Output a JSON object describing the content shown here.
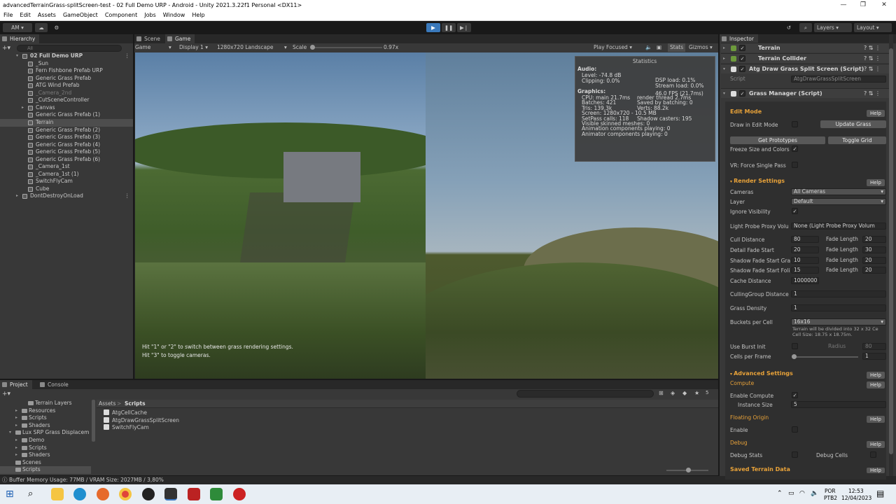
{
  "window": {
    "title": "advancedTerrainGrass-splitScreen-test - 02 Full Demo URP - Android - Unity 2021.3.22f1 Personal <DX11>",
    "min": "—",
    "max": "❐",
    "close": "✕"
  },
  "menu": [
    "File",
    "Edit",
    "Assets",
    "GameObject",
    "Component",
    "Jobs",
    "Window",
    "Help"
  ],
  "toolbar": {
    "account": "AM",
    "layers": "Layers",
    "layout": "Layout"
  },
  "hierarchy": {
    "tab": "Hierarchy",
    "search_placeholder": "All",
    "items": [
      {
        "label": "02 Full Demo URP",
        "indent": 0,
        "bold": true
      },
      {
        "label": "_Sun",
        "indent": 1
      },
      {
        "label": "Fern Fishbone Prefab URP",
        "indent": 1
      },
      {
        "label": "Generic Grass Prefab",
        "indent": 1
      },
      {
        "label": "ATG Wind Prefab",
        "indent": 1
      },
      {
        "label": "_Camera_2nd",
        "indent": 1,
        "dim": true
      },
      {
        "label": "_CutSceneController",
        "indent": 1
      },
      {
        "label": "Canvas",
        "indent": 1,
        "arrow": true
      },
      {
        "label": "Generic Grass Prefab (1)",
        "indent": 1
      },
      {
        "label": "Terrain",
        "indent": 1,
        "selected": true
      },
      {
        "label": "Generic Grass Prefab (2)",
        "indent": 1
      },
      {
        "label": "Generic Grass Prefab (3)",
        "indent": 1
      },
      {
        "label": "Generic Grass Prefab (4)",
        "indent": 1
      },
      {
        "label": "Generic Grass Prefab (5)",
        "indent": 1
      },
      {
        "label": "Generic Grass Prefab (6)",
        "indent": 1
      },
      {
        "label": "_Camera_1st",
        "indent": 1
      },
      {
        "label": "_Camera_1st (1)",
        "indent": 1
      },
      {
        "label": "SwitchFlyCam",
        "indent": 1
      },
      {
        "label": "Cube",
        "indent": 1
      },
      {
        "label": "DontDestroyOnLoad",
        "indent": 0
      }
    ]
  },
  "game": {
    "tabs": [
      "Scene",
      "Game"
    ],
    "mode": "Game",
    "display": "Display 1",
    "resolution": "1280x720 Landscape",
    "scale_label": "Scale",
    "scale_value": "0.97x",
    "play_mode": "Play Focused",
    "stats": "Stats",
    "gizmos": "Gizmos",
    "hint1": "Hit \"1\" or \"2\" to switch between grass rendering settings.",
    "hint2": "Hit \"3\" to toggle cameras.",
    "statistics": {
      "title": "Statistics",
      "audio_header": "Audio:",
      "audio_left": [
        "Level: -74.8 dB",
        "Clipping: 0.0%"
      ],
      "audio_right": [
        "DSP load: 0.1%",
        "Stream load: 0.0%"
      ],
      "fps": "46.0 FPS (21.7ms)",
      "graphics_header": "Graphics:",
      "graphics_left": [
        "CPU: main 21.7ms",
        "Batches: 421",
        "Tris: 139.3k",
        "Screen: 1280x720 - 10.5 MB",
        "SetPass calls: 118",
        "Visible skinned meshes: 0",
        "Animation components playing: 0",
        "Animator components playing: 0"
      ],
      "graphics_right": [
        "render thread 2.7ms",
        "Saved by batching: 0",
        "Verts: 88.2k",
        "",
        "Shadow casters: 195",
        "",
        "",
        ""
      ]
    }
  },
  "project": {
    "tabs": [
      "Project",
      "Console"
    ],
    "tree": [
      {
        "label": "Terrain Layers",
        "indent": 2
      },
      {
        "label": "Resources",
        "indent": 1,
        "arrow": true
      },
      {
        "label": "Scripts",
        "indent": 1,
        "arrow": true
      },
      {
        "label": "Shaders",
        "indent": 1,
        "arrow": true
      },
      {
        "label": "Lux SRP Grass Displacem",
        "indent": 0,
        "arrow": true
      },
      {
        "label": "Demo",
        "indent": 1,
        "arrow": true
      },
      {
        "label": "Scripts",
        "indent": 1,
        "arrow": true
      },
      {
        "label": "Shaders",
        "indent": 1,
        "arrow": true
      },
      {
        "label": "Scenes",
        "indent": 0
      },
      {
        "label": "Scripts",
        "indent": 0,
        "selected": true
      }
    ],
    "breadcrumb": [
      "Assets",
      "Scripts"
    ],
    "files": [
      "AtgCellCache",
      "AtgDrawGrassSplitScreen",
      "SwitchFlyCam"
    ],
    "badge": "5"
  },
  "status": "Buffer Memory Usage: 77MB / VRAM Size: 2027MB / 3,80%",
  "inspector": {
    "tab": "Inspector",
    "components": [
      "Terrain",
      "Terrain Collider",
      "Atg Draw Grass Split Screen (Script)",
      "Grass Manager (Script)"
    ],
    "script_label": "Script",
    "script_value": "AtgDrawGrassSplitScreen",
    "help": "Help",
    "edit_mode": "Edit Mode",
    "draw_in_edit": "Draw in Edit Mode",
    "update_grass": "Update Grass",
    "get_prototypes": "Get Prototypes",
    "toggle_grid": "Toggle Grid",
    "freeze": "Freeze Size and Colors",
    "vr": "VR: Force Single Pass",
    "render_settings": "Render Settings",
    "cameras": "Cameras",
    "cameras_val": "All Cameras",
    "layer": "Layer",
    "layer_val": "Default",
    "ignore_vis": "Ignore Visibility",
    "light_probe": "Light Probe Proxy Volu",
    "light_probe_val": "None (Light Probe Proxy Volum",
    "cull": "Cull Distance",
    "cull_val": "80",
    "detail_fade": "Detail Fade Start",
    "detail_val": "20",
    "shadow_grass": "Shadow Fade Start Gra",
    "shadow_grass_val": "10",
    "shadow_foli": "Shadow Fade Start Foli",
    "shadow_foli_val": "15",
    "fade_length": "Fade Length",
    "fade_vals": [
      "20",
      "30",
      "20",
      "20"
    ],
    "cache": "Cache Distance",
    "cache_val": "1000000",
    "culling_group": "CullingGroup Distance",
    "culling_val": "1",
    "density": "Grass Density",
    "density_val": "1",
    "buckets": "Buckets per Cell",
    "buckets_val": "16x16",
    "bucket_note1": "Terrain will be divided into 32 x 32 Ce",
    "bucket_note2": "Cell Size: 18.75 x 18.75m.",
    "burst": "Use Burst Init",
    "radius": "Radius",
    "radius_val": "80",
    "cells_frame": "Cells per Frame",
    "cells_frame_val": "1",
    "advanced": "Advanced Settings",
    "compute": "Compute",
    "enable_compute": "Enable Compute",
    "instance_size": "Instance Size",
    "instance_val": "5",
    "floating": "Floating Origin",
    "enable": "Enable",
    "debug": "Debug",
    "debug_stats": "Debug Stats",
    "debug_cells": "Debug Cells",
    "saved": "Saved Terrain Data"
  },
  "taskbar": {
    "lang1": "POR",
    "lang2": "PTB2",
    "time": "12:53",
    "date": "12/04/2023"
  }
}
